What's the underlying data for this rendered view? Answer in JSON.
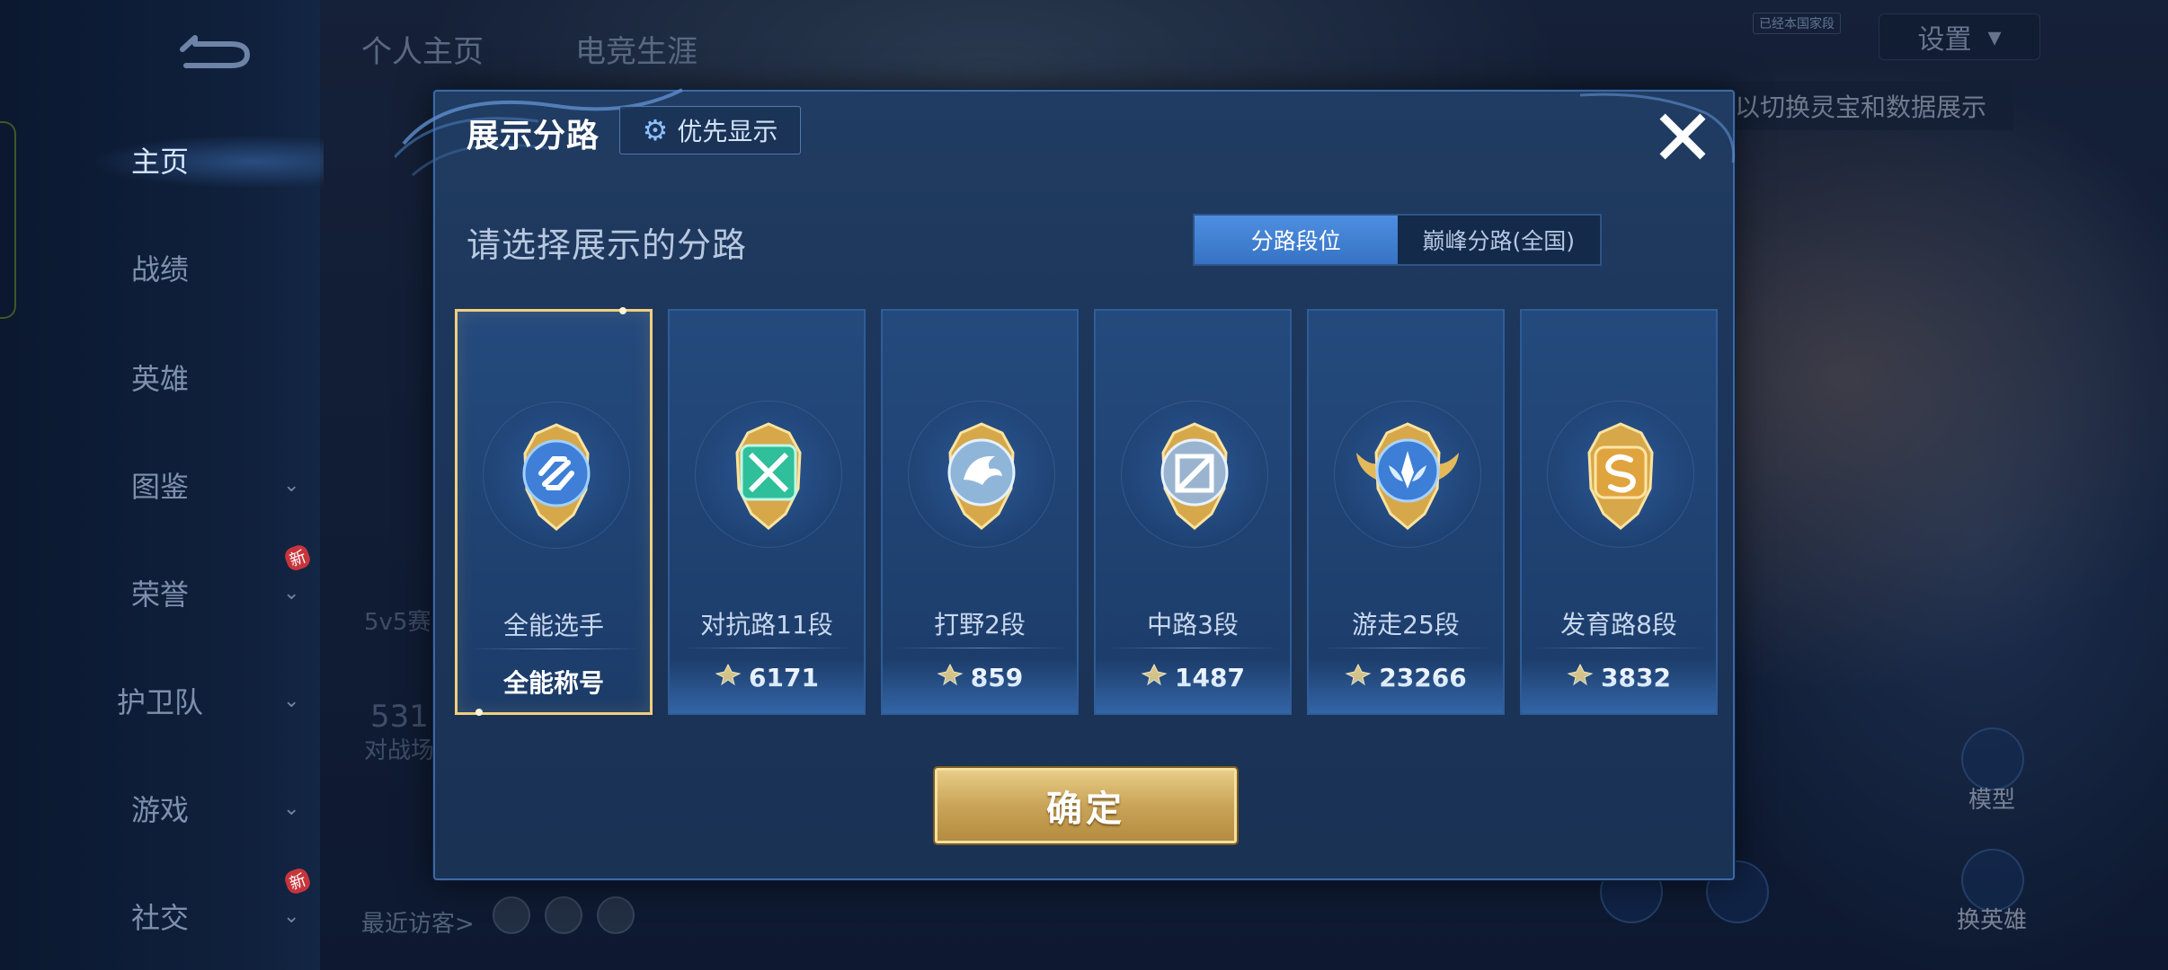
{
  "sidebar": {
    "back_icon": "back-arrow-icon",
    "items": [
      {
        "label": "主页",
        "active": true,
        "chevron": false,
        "new": false
      },
      {
        "label": "战绩",
        "active": false,
        "chevron": false,
        "new": false
      },
      {
        "label": "英雄",
        "active": false,
        "chevron": false,
        "new": false
      },
      {
        "label": "图鉴",
        "active": false,
        "chevron": true,
        "new": false
      },
      {
        "label": "荣誉",
        "active": false,
        "chevron": true,
        "new": true
      },
      {
        "label": "护卫队",
        "active": false,
        "chevron": true,
        "new": false
      },
      {
        "label": "游戏",
        "active": false,
        "chevron": true,
        "new": false
      },
      {
        "label": "社交",
        "active": false,
        "chevron": true,
        "new": true
      }
    ],
    "new_tag": "新",
    "chevron_glyph": "⌄"
  },
  "background": {
    "tab_profile": "个人主页",
    "tab_esports": "电竞生涯",
    "settings_label": "设置",
    "settings_chevron": "▾",
    "badge_small": "已经本国家段",
    "toast_text": "以切换灵宝和数据展示",
    "partial_stat": "5v5赛",
    "partial_number": "531",
    "partial_field": "对战场",
    "recent_visitors": "最近访客>",
    "model_label": "模型",
    "switch_hero_label": "换英雄"
  },
  "modal": {
    "title": "展示分路",
    "priority_button": "优先显示",
    "priority_icon": "gear-icon",
    "close_icon": "close-icon",
    "subtitle": "请选择展示的分路",
    "segments": [
      {
        "label": "分路段位",
        "active": true
      },
      {
        "label": "巅峰分路(全国)",
        "active": false
      }
    ],
    "cards": [
      {
        "name": "全能选手",
        "value": "全能称号",
        "show_point_icon": false,
        "selected": true,
        "emblem": "all-round-emblem-icon",
        "color": "#3f7fd8"
      },
      {
        "name": "对抗路11段",
        "value": "6171",
        "show_point_icon": true,
        "selected": false,
        "emblem": "clash-lane-emblem-icon",
        "color": "#2fbf9a"
      },
      {
        "name": "打野2段",
        "value": "859",
        "show_point_icon": true,
        "selected": false,
        "emblem": "jungle-emblem-icon",
        "color": "#8fb6d9"
      },
      {
        "name": "中路3段",
        "value": "1487",
        "show_point_icon": true,
        "selected": false,
        "emblem": "mid-lane-emblem-icon",
        "color": "#9ab4d0"
      },
      {
        "name": "游走25段",
        "value": "23266",
        "show_point_icon": true,
        "selected": false,
        "emblem": "roam-emblem-icon",
        "color": "#3d7ed6"
      },
      {
        "name": "发育路8段",
        "value": "3832",
        "show_point_icon": true,
        "selected": false,
        "emblem": "farm-lane-emblem-icon",
        "color": "#e0a43e"
      }
    ],
    "confirm_button": "确定"
  },
  "colors": {
    "accent_gold": "#f1cf7e",
    "segment_active": "#4e8ee0",
    "modal_bg": "#1c355a"
  }
}
